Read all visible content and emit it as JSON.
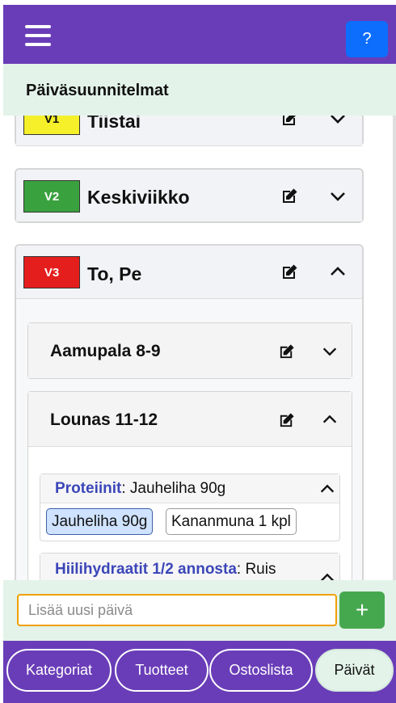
{
  "header": {
    "help_label": "?"
  },
  "page_title": "Päiväsuunnitelmat",
  "days": [
    {
      "badge": "V1",
      "badge_color": "#f5f02a",
      "badge_text_color": "#111111",
      "name": "Tiistai",
      "expanded": false
    },
    {
      "badge": "V2",
      "badge_color": "#3aa13f",
      "badge_text_color": "#ffffff",
      "name": "Keskiviikko",
      "expanded": false
    },
    {
      "badge": "V3",
      "badge_color": "#e41d1d",
      "badge_text_color": "#ffffff",
      "name": "To, Pe",
      "expanded": true
    }
  ],
  "meals": [
    {
      "name": "Aamupala 8-9",
      "expanded": false
    },
    {
      "name": "Lounas 11-12",
      "expanded": true
    }
  ],
  "categories": [
    {
      "name": "Proteiinit",
      "value": ": Jauheliha 90g",
      "chips": [
        "Jauheliha 90g",
        "Kananmuna 1 kpl"
      ],
      "selected_chip": 0
    },
    {
      "name": "Hiilihydraatit 1/2 annosta",
      "value": ": Ruis"
    }
  ],
  "add_day": {
    "placeholder": "Lisää uusi päivä",
    "button_label": "+"
  },
  "nav": {
    "items": [
      "Kategoriat",
      "Tuotteet",
      "Ostoslista",
      "Päivät"
    ],
    "active": "Päivät"
  }
}
